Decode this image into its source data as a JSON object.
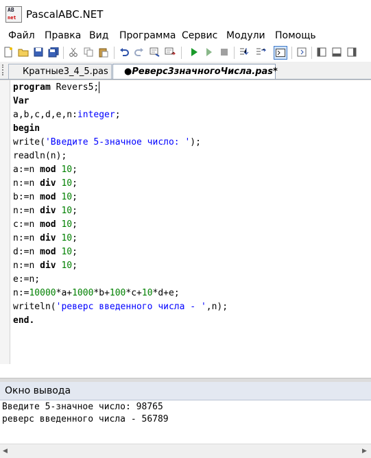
{
  "window": {
    "title": "PascalABC.NET",
    "icon": "pascalabc-app-icon",
    "icon_text_top": "AB",
    "icon_text_bottom": "net"
  },
  "menu": [
    "Файл",
    "Правка",
    "Вид",
    "Программа",
    "Сервис",
    "Модули",
    "Помощь"
  ],
  "toolbar": [
    "new-file-icon",
    "open-folder-icon",
    "save-icon",
    "save-all-icon",
    "cut-icon",
    "copy-icon",
    "paste-icon",
    "undo-icon",
    "redo-icon",
    "search-icon",
    "replace-icon",
    "run-icon",
    "debug-step-icon",
    "stop-icon",
    "step-into-icon",
    "step-over-icon",
    "console-window-icon",
    "output-icon",
    "dock-left-icon",
    "dock-bottom-icon",
    "dock-right-icon"
  ],
  "tabs": [
    {
      "label": "Кратные3_4_5.pas",
      "active": false
    },
    {
      "label": "●Реверс3значногоЧисла.pas*",
      "active": true
    }
  ],
  "editor": {
    "lines": [
      [
        {
          "t": "kw",
          "v": "program"
        },
        {
          "t": "id",
          "v": " Revers5"
        },
        {
          "t": "id",
          "v": ";"
        }
      ],
      [
        {
          "t": "kw",
          "v": "Var"
        }
      ],
      [
        {
          "t": "id",
          "v": "a,b,c,d,e,n:"
        },
        {
          "t": "typ",
          "v": "integer"
        },
        {
          "t": "id",
          "v": ";"
        }
      ],
      [
        {
          "t": "kw",
          "v": "begin"
        }
      ],
      [
        {
          "t": "id",
          "v": "write("
        },
        {
          "t": "str",
          "v": "'Введите 5-значное число: '"
        },
        {
          "t": "id",
          "v": ");"
        }
      ],
      [
        {
          "t": "id",
          "v": "readln(n);"
        }
      ],
      [
        {
          "t": "id",
          "v": "a:=n "
        },
        {
          "t": "kw",
          "v": "mod"
        },
        {
          "t": "id",
          "v": " "
        },
        {
          "t": "num",
          "v": "10"
        },
        {
          "t": "id",
          "v": ";"
        }
      ],
      [
        {
          "t": "id",
          "v": "n:=n "
        },
        {
          "t": "kw",
          "v": "div"
        },
        {
          "t": "id",
          "v": " "
        },
        {
          "t": "num",
          "v": "10"
        },
        {
          "t": "id",
          "v": ";"
        }
      ],
      [
        {
          "t": "id",
          "v": "b:=n "
        },
        {
          "t": "kw",
          "v": "mod"
        },
        {
          "t": "id",
          "v": " "
        },
        {
          "t": "num",
          "v": "10"
        },
        {
          "t": "id",
          "v": ";"
        }
      ],
      [
        {
          "t": "id",
          "v": "n:=n "
        },
        {
          "t": "kw",
          "v": "div"
        },
        {
          "t": "id",
          "v": " "
        },
        {
          "t": "num",
          "v": "10"
        },
        {
          "t": "id",
          "v": ";"
        }
      ],
      [
        {
          "t": "id",
          "v": "c:=n "
        },
        {
          "t": "kw",
          "v": "mod"
        },
        {
          "t": "id",
          "v": " "
        },
        {
          "t": "num",
          "v": "10"
        },
        {
          "t": "id",
          "v": ";"
        }
      ],
      [
        {
          "t": "id",
          "v": "n:=n "
        },
        {
          "t": "kw",
          "v": "div"
        },
        {
          "t": "id",
          "v": " "
        },
        {
          "t": "num",
          "v": "10"
        },
        {
          "t": "id",
          "v": ";"
        }
      ],
      [
        {
          "t": "id",
          "v": "d:=n "
        },
        {
          "t": "kw",
          "v": "mod"
        },
        {
          "t": "id",
          "v": " "
        },
        {
          "t": "num",
          "v": "10"
        },
        {
          "t": "id",
          "v": ";"
        }
      ],
      [
        {
          "t": "id",
          "v": "n:=n "
        },
        {
          "t": "kw",
          "v": "div"
        },
        {
          "t": "id",
          "v": " "
        },
        {
          "t": "num",
          "v": "10"
        },
        {
          "t": "id",
          "v": ";"
        }
      ],
      [
        {
          "t": "id",
          "v": "e:=n;"
        }
      ],
      [
        {
          "t": "id",
          "v": "n:="
        },
        {
          "t": "num",
          "v": "10000"
        },
        {
          "t": "id",
          "v": "*a+"
        },
        {
          "t": "num",
          "v": "1000"
        },
        {
          "t": "id",
          "v": "*b+"
        },
        {
          "t": "num",
          "v": "100"
        },
        {
          "t": "id",
          "v": "*c+"
        },
        {
          "t": "num",
          "v": "10"
        },
        {
          "t": "id",
          "v": "*d+e;"
        }
      ],
      [
        {
          "t": "id",
          "v": "writeln("
        },
        {
          "t": "str",
          "v": "'реверс введенного числа - '"
        },
        {
          "t": "id",
          "v": ",n);"
        }
      ],
      [
        {
          "t": "kw",
          "v": "end."
        }
      ]
    ]
  },
  "output_panel": {
    "title": "Окно вывода",
    "lines": [
      "Введите 5-значное число: 98765",
      "реверс введенного числа - 56789"
    ]
  },
  "colors": {
    "keyword": "#000000",
    "number": "#008000",
    "string": "#0000ff",
    "type": "#0000ff",
    "output_header": "#e3e8f1"
  }
}
